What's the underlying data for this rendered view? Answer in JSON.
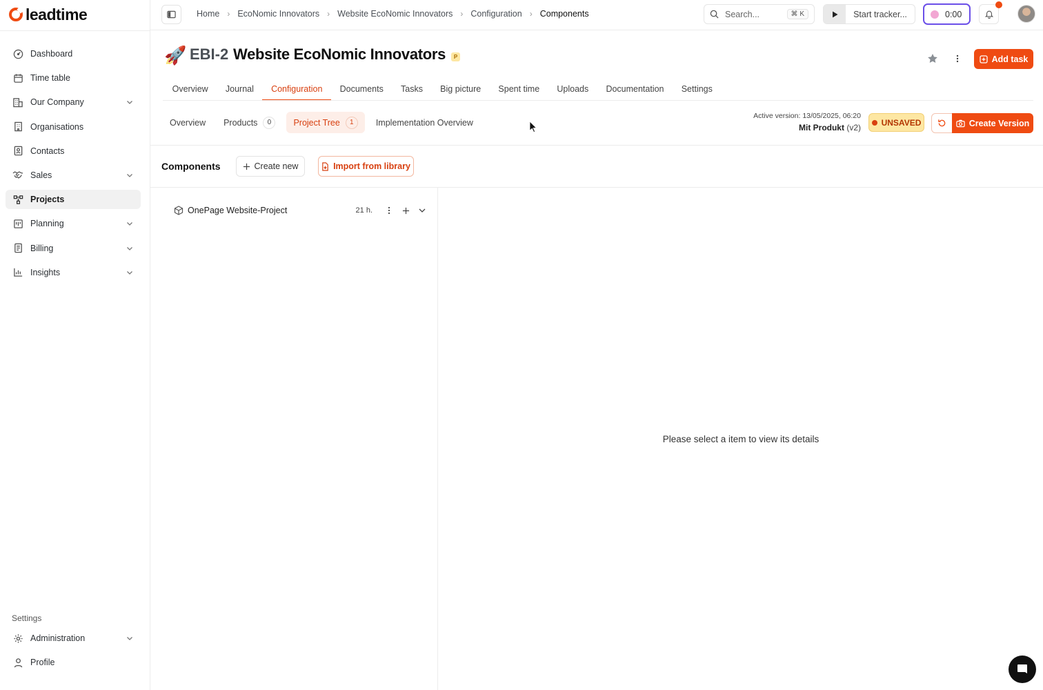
{
  "brand": {
    "name": "leadtime"
  },
  "sidebar": {
    "items": [
      {
        "label": "Dashboard",
        "icon": "dashboard-icon",
        "expandable": false
      },
      {
        "label": "Time table",
        "icon": "calendar-icon",
        "expandable": false
      },
      {
        "label": "Our Company",
        "icon": "building-icon",
        "expandable": true
      },
      {
        "label": "Organisations",
        "icon": "organisation-icon",
        "expandable": false
      },
      {
        "label": "Contacts",
        "icon": "contacts-icon",
        "expandable": false
      },
      {
        "label": "Sales",
        "icon": "handshake-icon",
        "expandable": true
      },
      {
        "label": "Projects",
        "icon": "projects-icon",
        "expandable": false,
        "active": true
      },
      {
        "label": "Planning",
        "icon": "planning-icon",
        "expandable": true
      },
      {
        "label": "Billing",
        "icon": "billing-icon",
        "expandable": true
      },
      {
        "label": "Insights",
        "icon": "insights-icon",
        "expandable": true
      }
    ],
    "settings_heading": "Settings",
    "bottom_items": [
      {
        "label": "Administration",
        "icon": "gear-icon",
        "expandable": true
      },
      {
        "label": "Profile",
        "icon": "user-icon",
        "expandable": false
      }
    ]
  },
  "topbar": {
    "breadcrumb": [
      "Home",
      "EcoNomic Innovators",
      "Website EcoNomic Innovators",
      "Configuration",
      "Components"
    ],
    "search_placeholder": "Search...",
    "search_shortcut": "⌘ K",
    "tracker_label": "Start tracker...",
    "timer_value": "0:00"
  },
  "project": {
    "emoji": "🚀",
    "code": "EBI-2",
    "title": "Website EcoNomic Innovators",
    "badge": "P",
    "add_task_label": "Add task",
    "tabs": [
      "Overview",
      "Journal",
      "Configuration",
      "Documents",
      "Tasks",
      "Big picture",
      "Spent time",
      "Uploads",
      "Documentation",
      "Settings"
    ],
    "active_tab": "Configuration"
  },
  "subtabs": [
    {
      "label": "Overview",
      "count": null
    },
    {
      "label": "Products",
      "count": "0"
    },
    {
      "label": "Project Tree",
      "count": "1",
      "active": true
    },
    {
      "label": "Implementation Overview",
      "count": null
    }
  ],
  "version": {
    "active_label": "Active version:",
    "active_date": "13/05/2025, 06:20",
    "product_name": "Mit Produkt",
    "product_version": "(v2)",
    "status": "UNSAVED",
    "create_label": "Create Version"
  },
  "components": {
    "title": "Components",
    "create_new_label": "Create new",
    "import_label": "Import from library",
    "tree": [
      {
        "name": "OnePage Website-Project",
        "hours": "21 h."
      }
    ],
    "empty_detail": "Please select a item to view its details"
  },
  "colors": {
    "accent": "#ef4b12",
    "unsaved_bg": "#fde7a3",
    "timer_border": "#6b4fe8"
  }
}
